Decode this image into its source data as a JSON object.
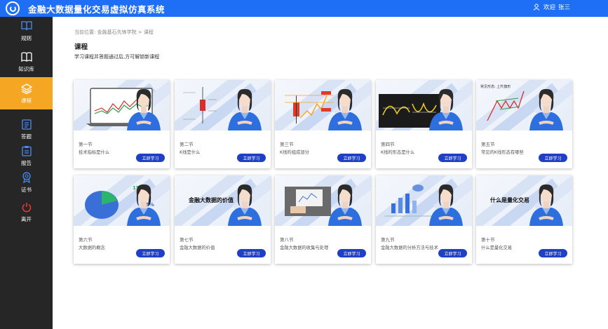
{
  "header": {
    "title": "金融大数据量化交易虚拟仿真系统",
    "welcome": "欢迎",
    "username": "张三"
  },
  "sidebar": {
    "items": [
      {
        "label": "规则",
        "icon": "book-icon",
        "active": false
      },
      {
        "label": "知识库",
        "icon": "open-book-icon",
        "active": false
      },
      {
        "label": "课程",
        "icon": "layers-icon",
        "active": true
      },
      {
        "label": "答题",
        "icon": "checklist-icon",
        "active": false
      },
      {
        "label": "报告",
        "icon": "clipboard-icon",
        "active": false
      },
      {
        "label": "证书",
        "icon": "certificate-icon",
        "active": false
      },
      {
        "label": "离开",
        "icon": "power-icon",
        "active": false
      }
    ]
  },
  "breadcrumb": {
    "prefix": "当前位置:",
    "path": "金融基石先锋学院 > 课程"
  },
  "page": {
    "title": "课程",
    "subtitle": "学习课程并答题通过后,方可解锁新课程"
  },
  "courses": [
    {
      "section": "第一节",
      "title": "技术指标是什么",
      "button": "立即学习",
      "thumb": "laptop-chart"
    },
    {
      "section": "第二节",
      "title": "K线是什么",
      "button": "立即学习",
      "thumb": "candlestick"
    },
    {
      "section": "第三节",
      "title": "K线的组成部分",
      "button": "立即学习",
      "thumb": "k-parts"
    },
    {
      "section": "第四节",
      "title": "K线的形态是什么",
      "button": "立即学习",
      "thumb": "k-patterns"
    },
    {
      "section": "第五节",
      "title": "常见的K线形态有哪些",
      "button": "立即学习",
      "thumb": "k-common",
      "thumb_text": "常见形态: 上升旗形"
    },
    {
      "section": "第六节",
      "title": "大数据的概念",
      "button": "立即学习",
      "thumb": "pie",
      "thumb_text": [
        "15%",
        "85%"
      ]
    },
    {
      "section": "第七节",
      "title": "金融大数据的价值",
      "button": "立即学习",
      "thumb": "value-text",
      "thumb_text": "金融大数据的价值"
    },
    {
      "section": "第八节",
      "title": "金融大数据的收集与处理",
      "button": "立即学习",
      "thumb": "photo"
    },
    {
      "section": "第九节",
      "title": "金融大数据的分析方法与技术",
      "button": "立即学习",
      "thumb": "analysis"
    },
    {
      "section": "第十节",
      "title": "什么是量化交易",
      "button": "立即学习",
      "thumb": "quant-text",
      "thumb_text": "什么是量化交易"
    }
  ],
  "colors": {
    "topbar": "#1e6ff5",
    "sidebar": "#262626",
    "active": "#f5a623",
    "button": "#1f3fc4"
  }
}
